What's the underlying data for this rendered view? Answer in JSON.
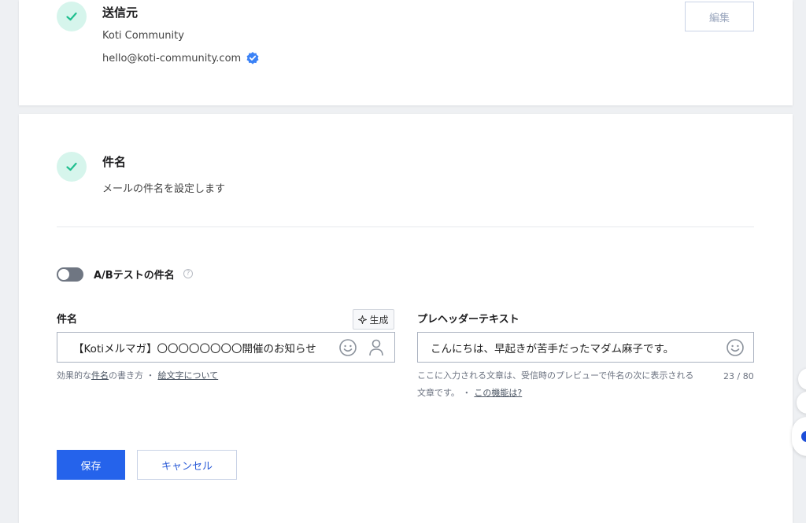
{
  "sender_section": {
    "title": "送信元",
    "name": "Koti Community",
    "email": "hello@koti-community.com",
    "edit_label": "編集"
  },
  "subject_section": {
    "title": "件名",
    "description": "メールの件名を設定します",
    "ab_toggle_label": "A/Bテストの件名",
    "ab_toggle_on": false,
    "help_icon_text": "?",
    "subject_field": {
      "label": "件名",
      "generate_label": "生成",
      "value": "【Kotiメルマガ】〇〇〇〇〇〇〇〇開催のお知らせ",
      "hint_prefix": "効果的な",
      "hint_link1": "件名",
      "hint_middle": "の書き方 ・",
      "hint_link2": "絵文字について"
    },
    "preheader_field": {
      "label": "プレヘッダーテキスト",
      "value": "こんにちは、早起きが苦手だったマダム麻子です。",
      "hint_line1": "ここに入力される文章は、受信時のプレビューで件名の次に表示される",
      "hint_line2": "文章です。 ・",
      "hint_link": "この機能は?",
      "counter": "23 / 80"
    },
    "save_label": "保存",
    "cancel_label": "キャンセル"
  },
  "colors": {
    "accent": "#2563eb",
    "check_bg": "#d6f5ec",
    "check_mark": "#1fbf8f",
    "verified": "#3b82f6"
  }
}
